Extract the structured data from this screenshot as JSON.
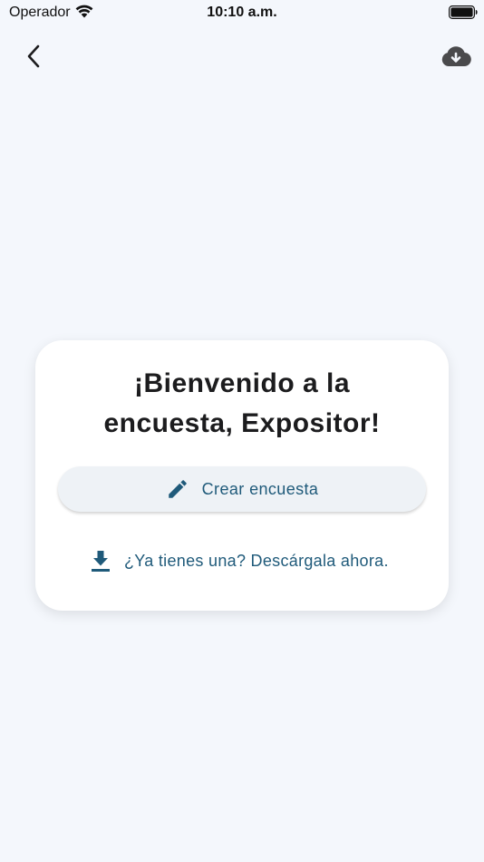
{
  "status_bar": {
    "carrier": "Operador",
    "time": "10:10 a.m."
  },
  "nav": {
    "back_icon": "chevron-left-icon",
    "action_icon": "cloud-download-icon"
  },
  "welcome_card": {
    "title_line1": "¡Bienvenido a la",
    "title_line2": "encuesta, Expositor!",
    "create_button_label": "Crear encuesta",
    "create_button_icon": "pencil-icon",
    "download_link_label": "¿Ya tienes una? Descárgala ahora.",
    "download_link_icon": "download-icon"
  },
  "colors": {
    "background": "#f4f7fc",
    "accent": "#1f5a7a",
    "card": "#ffffff",
    "button_bg": "#eef2f6"
  }
}
